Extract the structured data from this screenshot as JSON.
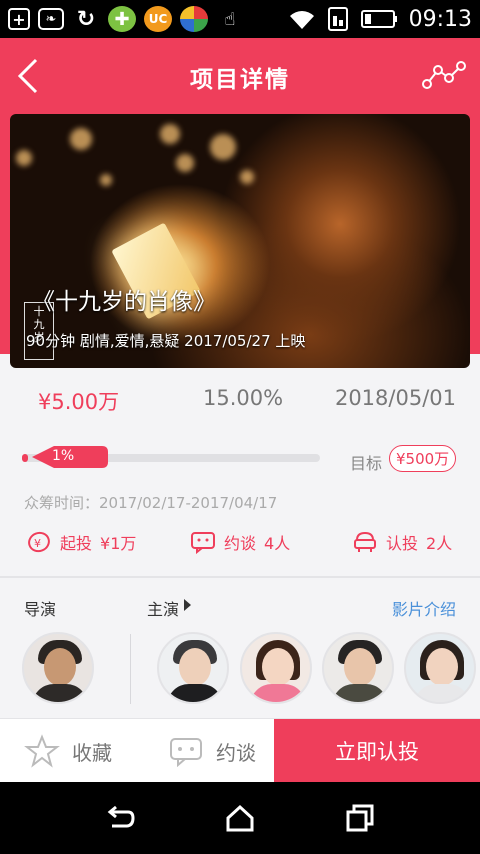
{
  "status_bar": {
    "time": "09:13",
    "left_icons": [
      "plus-icon",
      "leaf-icon",
      "sync-icon",
      "plus-badge-icon",
      "uc-browser-icon",
      "color-wheel-icon",
      "hand-icon"
    ],
    "right_icons": [
      "wifi-icon",
      "sim-icon",
      "battery-icon"
    ]
  },
  "header": {
    "title": "项目详情",
    "back_icon": "chevron-left-icon",
    "share_icon": "share-graph-icon"
  },
  "hero": {
    "film_title": "《十九岁的肖像》",
    "meta": "90分钟 剧情,爱情,悬疑 2017/05/27 上映"
  },
  "stats": {
    "amount": "¥5.00万",
    "percent": "15.00%",
    "date": "2018/05/01"
  },
  "progress": {
    "value_label": "1%",
    "fraction": 0.01,
    "target_label": "目标",
    "target_value": "¥500万"
  },
  "period": "众筹时间：2017/02/17-2017/04/17",
  "actions": [
    {
      "label": "起投",
      "value": "¥1万",
      "icon": "coin-icon"
    },
    {
      "label": "约谈",
      "value": "4人",
      "icon": "chat-icon"
    },
    {
      "label": "认投",
      "value": "2人",
      "icon": "invest-icon"
    }
  ],
  "cast": {
    "director_label": "导演",
    "actors_label": "主演",
    "intro_link": "影片介绍"
  },
  "bottom_bar": {
    "favorite": "收藏",
    "talk": "约谈",
    "invest": "立即认投"
  },
  "colors": {
    "brand": "#ef3e5b",
    "link": "#4a90d9"
  }
}
